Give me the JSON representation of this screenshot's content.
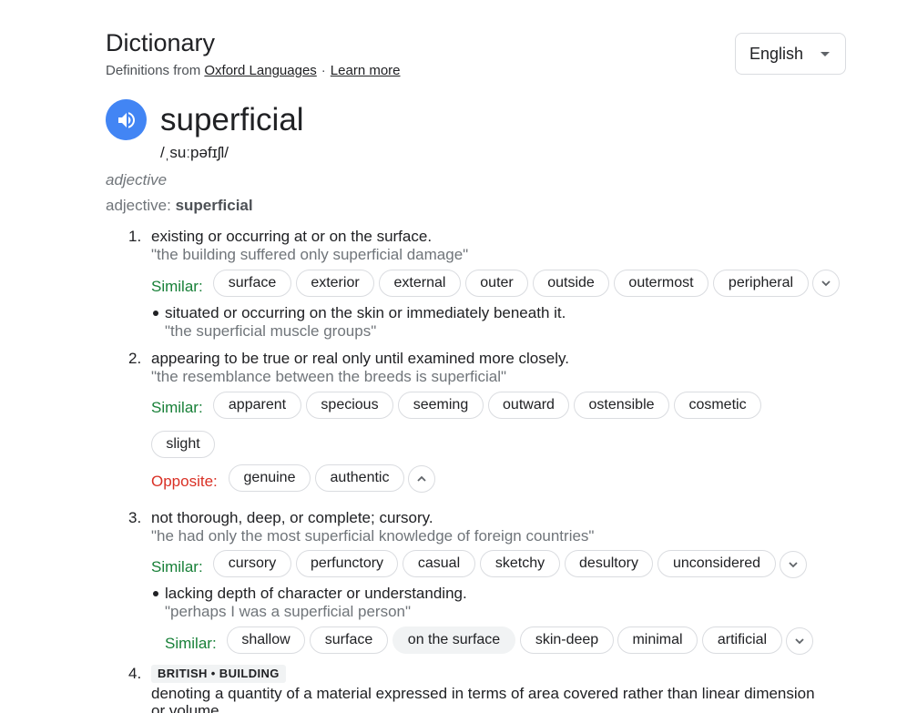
{
  "header": {
    "title": "Dictionary",
    "definitions_from": "Definitions from",
    "source_link": "Oxford Languages",
    "separator": "·",
    "learn_more": "Learn more",
    "language": "English"
  },
  "entry": {
    "word": "superficial",
    "phonetic": "/ˌsuːpəfɪʃl/",
    "part_of_speech": "adjective",
    "pos_prefix": "adjective",
    "pos_colon": ":",
    "pos_word": "superficial"
  },
  "senses": [
    {
      "number": "1.",
      "definition": "existing or occurring at or on the surface.",
      "example": "\"the building suffered only superficial damage\"",
      "similar_label": "Similar:",
      "similar": [
        "surface",
        "exterior",
        "external",
        "outer",
        "outside",
        "outermost",
        "peripheral"
      ],
      "sub": {
        "definition": "situated or occurring on the skin or immediately beneath it.",
        "example": "\"the superficial muscle groups\""
      }
    },
    {
      "number": "2.",
      "definition": "appearing to be true or real only until examined more closely.",
      "example": "\"the resemblance between the breeds is superficial\"",
      "similar_label": "Similar:",
      "similar": [
        "apparent",
        "specious",
        "seeming",
        "outward",
        "ostensible",
        "cosmetic",
        "slight"
      ],
      "opposite_label": "Opposite:",
      "opposite": [
        "genuine",
        "authentic"
      ]
    },
    {
      "number": "3.",
      "definition": "not thorough, deep, or complete; cursory.",
      "example": "\"he had only the most superficial knowledge of foreign countries\"",
      "similar_label": "Similar:",
      "similar": [
        "cursory",
        "perfunctory",
        "casual",
        "sketchy",
        "desultory",
        "unconsidered"
      ],
      "sub": {
        "definition": "lacking depth of character or understanding.",
        "example": "\"perhaps I was a superficial person\"",
        "similar_label": "Similar:",
        "similar": [
          "shallow",
          "surface",
          "on the surface",
          "skin-deep",
          "minimal",
          "artificial"
        ]
      }
    },
    {
      "number": "4.",
      "tag": "BRITISH • BUILDING",
      "definition_line1": "denoting a quantity of a material expressed in terms of area covered rather than linear dimension",
      "definition_line2": "or volume."
    }
  ],
  "colors": {
    "accent_blue": "#4285f4",
    "similar_green": "#188038",
    "opposite_red": "#d93025",
    "example_gray": "#70757a"
  }
}
